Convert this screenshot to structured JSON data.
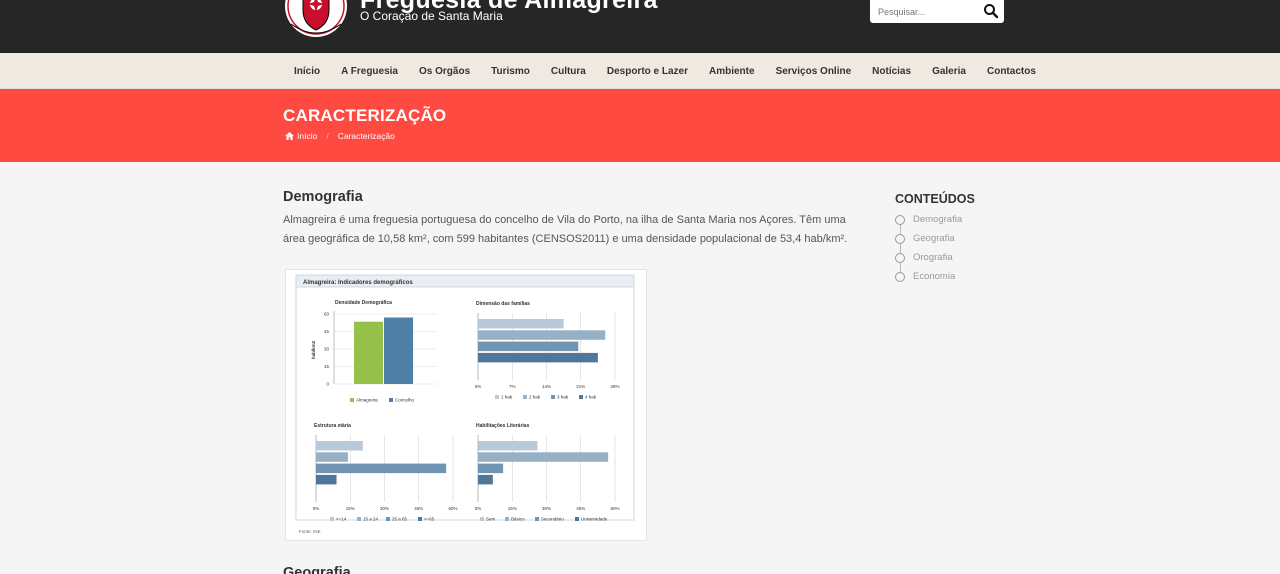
{
  "header": {
    "site_title": "Freguesia de Almagreira",
    "site_subtitle": "O Coração de Santa Maria",
    "logo_text": "ALMAGREIRA - VILA DO PORTO",
    "search_placeholder": "Pesquisar..."
  },
  "nav": {
    "items": [
      "Início",
      "A Freguesia",
      "Os Orgãos",
      "Turismo",
      "Cultura",
      "Desporto e Lazer",
      "Ambiente",
      "Serviços Online",
      "Notícias",
      "Galeria",
      "Contactos"
    ]
  },
  "banner": {
    "title": "CARACTERIZAÇÃO",
    "breadcrumb_home": "Início",
    "breadcrumb_sep": "/",
    "breadcrumb_current": "Caracterização"
  },
  "main": {
    "section1_title": "Demografia",
    "section1_text": "Almagreira é uma freguesia portuguesa do concelho de Vila do Porto, na ilha de Santa Maria nos Açores. Têm uma área geográfica de 10,58 km², com 599 habitantes (CENSOS2011) e uma densidade populacional de 53,4 hab/km².",
    "section2_title": "Geografia"
  },
  "sidebar": {
    "title": "CONTEÚDOS",
    "items": [
      "Demografia",
      "Geografia",
      "Orografia",
      "Economia"
    ]
  },
  "colors": {
    "topbar": "#262626",
    "nav_bg": "#efe9e1",
    "banner": "#ff4a42",
    "green": "#95c14a",
    "blue": "#4f7fa6"
  },
  "chart_data": {
    "panel_title": "Almagreira: Indicadores demográficos",
    "source": "Fonte: INE",
    "charts": [
      {
        "type": "bar",
        "title": "Densidade Demográfica",
        "ylabel": "hab/km2",
        "yticks": [
          "0",
          "15",
          "30",
          "45",
          "60"
        ],
        "ylim": [
          0,
          60
        ],
        "series": [
          {
            "name": "Almagreira",
            "values": [
              53.4
            ],
            "color": "#95c14a"
          },
          {
            "name": "Concelho",
            "values": [
              57
            ],
            "color": "#4f7fa6"
          }
        ]
      },
      {
        "type": "bar",
        "orientation": "horizontal",
        "title": "Dimensão das famílias",
        "xticks": [
          "0%",
          "7%",
          "14%",
          "21%",
          "28%"
        ],
        "xlim": [
          0,
          28
        ],
        "series": [
          {
            "name": "1 hab",
            "values": [
              17.5
            ],
            "color": "#b8cad9"
          },
          {
            "name": "2 hab",
            "values": [
              26
            ],
            "color": "#96b0c6"
          },
          {
            "name": "3 hab",
            "values": [
              20.5
            ],
            "color": "#7194b3"
          },
          {
            "name": "4 hab",
            "values": [
              24.5
            ],
            "color": "#4f7799"
          }
        ]
      },
      {
        "type": "bar",
        "orientation": "horizontal",
        "title": "Estrutura etária",
        "xticks": [
          "0%",
          "15%",
          "30%",
          "45%",
          "60%"
        ],
        "xlim": [
          0,
          60
        ],
        "series": [
          {
            "name": "<=14",
            "values": [
              20.5
            ],
            "color": "#b8cad9"
          },
          {
            "name": "15 a 24",
            "values": [
              14
            ],
            "color": "#96b0c6"
          },
          {
            "name": "25 a 65",
            "values": [
              57
            ],
            "color": "#7194b3"
          },
          {
            "name": ">=65",
            "values": [
              9
            ],
            "color": "#4f7799"
          }
        ]
      },
      {
        "type": "bar",
        "orientation": "horizontal",
        "title": "Habilitações Literárias",
        "xticks": [
          "0%",
          "15%",
          "30%",
          "45%",
          "60%"
        ],
        "xlim": [
          0,
          60
        ],
        "series": [
          {
            "name": "Sem",
            "values": [
              26
            ],
            "color": "#b8cad9"
          },
          {
            "name": "Básico",
            "values": [
              57
            ],
            "color": "#96b0c6"
          },
          {
            "name": "Secundário",
            "values": [
              11
            ],
            "color": "#7194b3"
          },
          {
            "name": "Universidade",
            "values": [
              6.5
            ],
            "color": "#4f7799"
          }
        ]
      }
    ]
  }
}
